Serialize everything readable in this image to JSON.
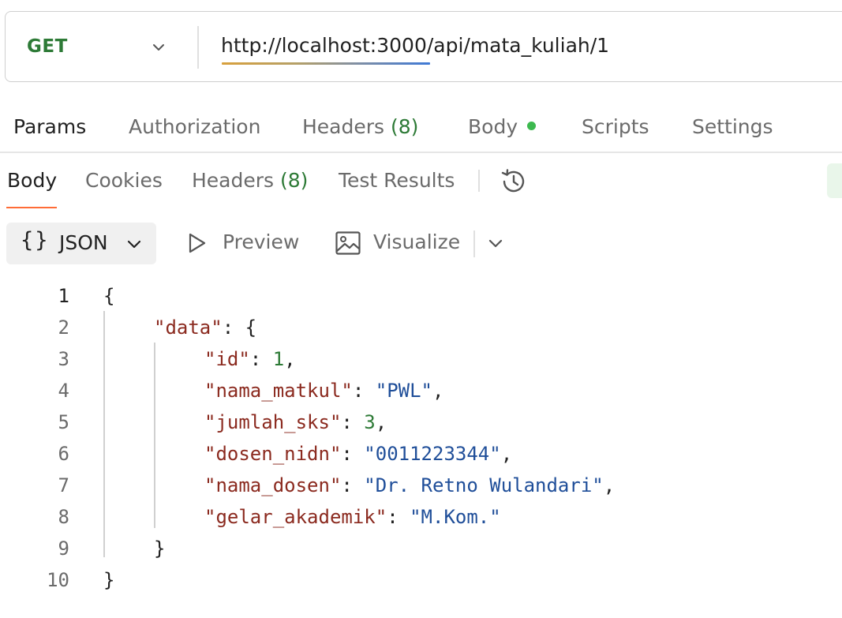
{
  "request": {
    "method": "GET",
    "url": "http://localhost:3000/api/mata_kuliah/1"
  },
  "request_tabs": {
    "params": "Params",
    "authorization": "Authorization",
    "headers_label": "Headers",
    "headers_count": "(8)",
    "body": "Body",
    "scripts": "Scripts",
    "settings": "Settings"
  },
  "response_tabs": {
    "body": "Body",
    "cookies": "Cookies",
    "headers_label": "Headers",
    "headers_count": "(8)",
    "test_results": "Test Results"
  },
  "toolbar": {
    "format_braces": "{}",
    "format_label": "JSON",
    "preview_label": "Preview",
    "visualize_label": "Visualize"
  },
  "code": {
    "line_numbers": [
      "1",
      "2",
      "3",
      "4",
      "5",
      "6",
      "7",
      "8",
      "9",
      "10"
    ],
    "open_brace": "{",
    "close_brace": "}",
    "data_key": "\"data\"",
    "fields": [
      {
        "key": "\"id\"",
        "value": "1",
        "type": "number",
        "comma": ","
      },
      {
        "key": "\"nama_matkul\"",
        "value": "\"PWL\"",
        "type": "string",
        "comma": ","
      },
      {
        "key": "\"jumlah_sks\"",
        "value": "3",
        "type": "number",
        "comma": ","
      },
      {
        "key": "\"dosen_nidn\"",
        "value": "\"0011223344\"",
        "type": "string",
        "comma": ","
      },
      {
        "key": "\"nama_dosen\"",
        "value": "\"Dr. Retno Wulandari\"",
        "type": "string",
        "comma": ","
      },
      {
        "key": "\"gelar_akademik\"",
        "value": "\"M.Kom.\"",
        "type": "string",
        "comma": ""
      }
    ]
  },
  "colors": {
    "method_green": "#2d7a36",
    "active_tab_accent": "#ff6c37",
    "body_dot": "#3cb94f",
    "json_key": "#8b2a1f",
    "json_string": "#1f4e99",
    "json_number": "#2d7a36"
  }
}
